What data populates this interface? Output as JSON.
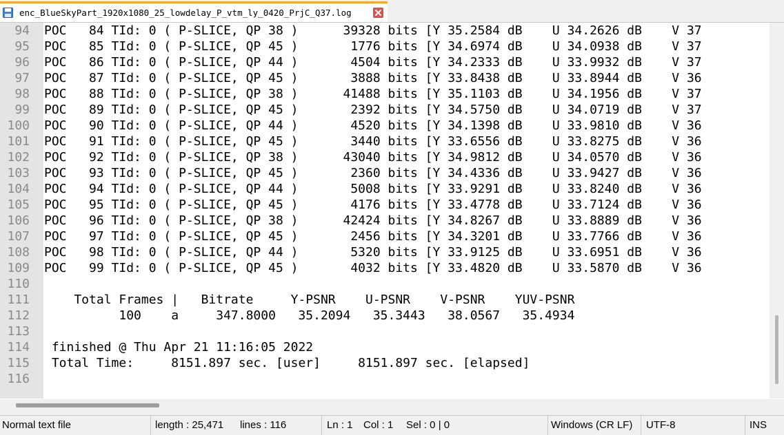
{
  "tab": {
    "title": "enc_BlueSkyPart_1920x1080_25_lowdelay_P_vtm_ly_0420_PrjC_Q37.log",
    "icon": "save-disk-icon",
    "close_icon": "close-icon"
  },
  "editor": {
    "lines": [
      {
        "num": "94",
        "text": "POC   84 TId: 0 ( P-SLICE, QP 38 )      39328 bits [Y 35.2584 dB    U 34.2626 dB    V 37"
      },
      {
        "num": "95",
        "text": "POC   85 TId: 0 ( P-SLICE, QP 45 )       1776 bits [Y 34.6974 dB    U 34.0938 dB    V 37"
      },
      {
        "num": "96",
        "text": "POC   86 TId: 0 ( P-SLICE, QP 44 )       4504 bits [Y 34.2333 dB    U 33.9932 dB    V 37"
      },
      {
        "num": "97",
        "text": "POC   87 TId: 0 ( P-SLICE, QP 45 )       3888 bits [Y 33.8438 dB    U 33.8944 dB    V 36"
      },
      {
        "num": "98",
        "text": "POC   88 TId: 0 ( P-SLICE, QP 38 )      41488 bits [Y 35.1103 dB    U 34.1956 dB    V 37"
      },
      {
        "num": "99",
        "text": "POC   89 TId: 0 ( P-SLICE, QP 45 )       2392 bits [Y 34.5750 dB    U 34.0719 dB    V 37"
      },
      {
        "num": "100",
        "text": "POC   90 TId: 0 ( P-SLICE, QP 44 )       4520 bits [Y 34.1398 dB    U 33.9810 dB    V 36"
      },
      {
        "num": "101",
        "text": "POC   91 TId: 0 ( P-SLICE, QP 45 )       3440 bits [Y 33.6556 dB    U 33.8275 dB    V 36"
      },
      {
        "num": "102",
        "text": "POC   92 TId: 0 ( P-SLICE, QP 38 )      43040 bits [Y 34.9812 dB    U 34.0570 dB    V 36"
      },
      {
        "num": "103",
        "text": "POC   93 TId: 0 ( P-SLICE, QP 45 )       2360 bits [Y 34.4336 dB    U 33.9427 dB    V 36"
      },
      {
        "num": "104",
        "text": "POC   94 TId: 0 ( P-SLICE, QP 44 )       5008 bits [Y 33.9291 dB    U 33.8240 dB    V 36"
      },
      {
        "num": "105",
        "text": "POC   95 TId: 0 ( P-SLICE, QP 45 )       4176 bits [Y 33.4778 dB    U 33.7124 dB    V 36"
      },
      {
        "num": "106",
        "text": "POC   96 TId: 0 ( P-SLICE, QP 38 )      42424 bits [Y 34.8267 dB    U 33.8889 dB    V 36"
      },
      {
        "num": "107",
        "text": "POC   97 TId: 0 ( P-SLICE, QP 45 )       2456 bits [Y 34.3201 dB    U 33.7766 dB    V 36"
      },
      {
        "num": "108",
        "text": "POC   98 TId: 0 ( P-SLICE, QP 44 )       5320 bits [Y 33.9125 dB    U 33.6951 dB    V 36"
      },
      {
        "num": "109",
        "text": "POC   99 TId: 0 ( P-SLICE, QP 45 )       4032 bits [Y 33.4820 dB    U 33.5870 dB    V 36"
      },
      {
        "num": "110",
        "text": ""
      },
      {
        "num": "111",
        "text": "    Total Frames |   Bitrate     Y-PSNR    U-PSNR    V-PSNR    YUV-PSNR"
      },
      {
        "num": "112",
        "text": "          100    a     347.8000   35.2094   35.3443   38.0567   35.4934"
      },
      {
        "num": "113",
        "text": ""
      },
      {
        "num": "114",
        "text": " finished @ Thu Apr 21 11:16:05 2022"
      },
      {
        "num": "115",
        "text": " Total Time:     8151.897 sec. [user]     8151.897 sec. [elapsed]"
      },
      {
        "num": "116",
        "text": ""
      }
    ]
  },
  "status": {
    "file_type": "Normal text file",
    "length": "length : 25,471",
    "lines": "lines : 116",
    "ln": "Ln : 1",
    "col": "Col : 1",
    "sel": "Sel : 0 | 0",
    "eol": "Windows (CR LF)",
    "encoding": "UTF-8",
    "mode": "INS"
  }
}
